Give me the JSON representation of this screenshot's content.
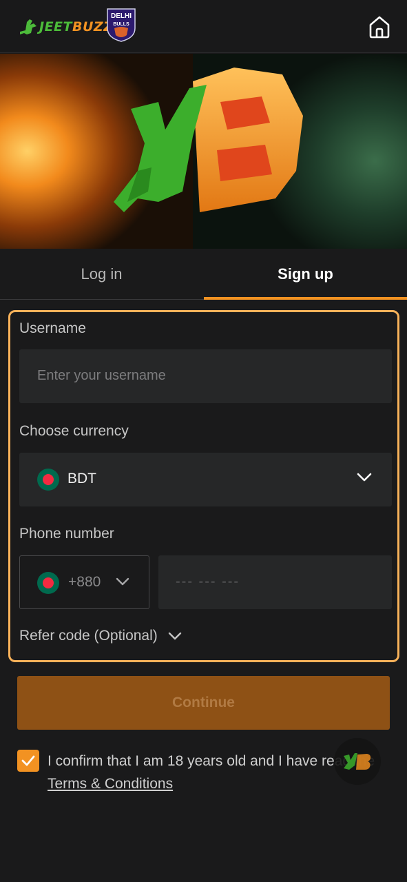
{
  "header": {
    "brand_prefix": "J",
    "brand_mid": "EET",
    "brand_suffix": "BUZZ",
    "partner_line1": "DELHI",
    "partner_line2": "BULLS",
    "home_icon": "home-icon"
  },
  "tabs": [
    {
      "label": "Log in",
      "active": false
    },
    {
      "label": "Sign up",
      "active": true
    }
  ],
  "form": {
    "username_label": "Username",
    "username_placeholder": "Enter your username",
    "currency_label": "Choose currency",
    "currency_value": "BDT",
    "phone_label": "Phone number",
    "phone_code": "+880",
    "phone_placeholder": "--- --- ---",
    "refer_label": "Refer code (Optional)"
  },
  "continue_label": "Continue",
  "confirm": {
    "checked": true,
    "text": "I confirm that I am 18 years old and I have read the ",
    "link": "Terms & Conditions"
  },
  "colors": {
    "accent": "#f29222",
    "brand_green": "#4cbb3a",
    "background": "#1a1a1b",
    "input_bg": "#262728",
    "continue_bg": "#8e5115"
  }
}
